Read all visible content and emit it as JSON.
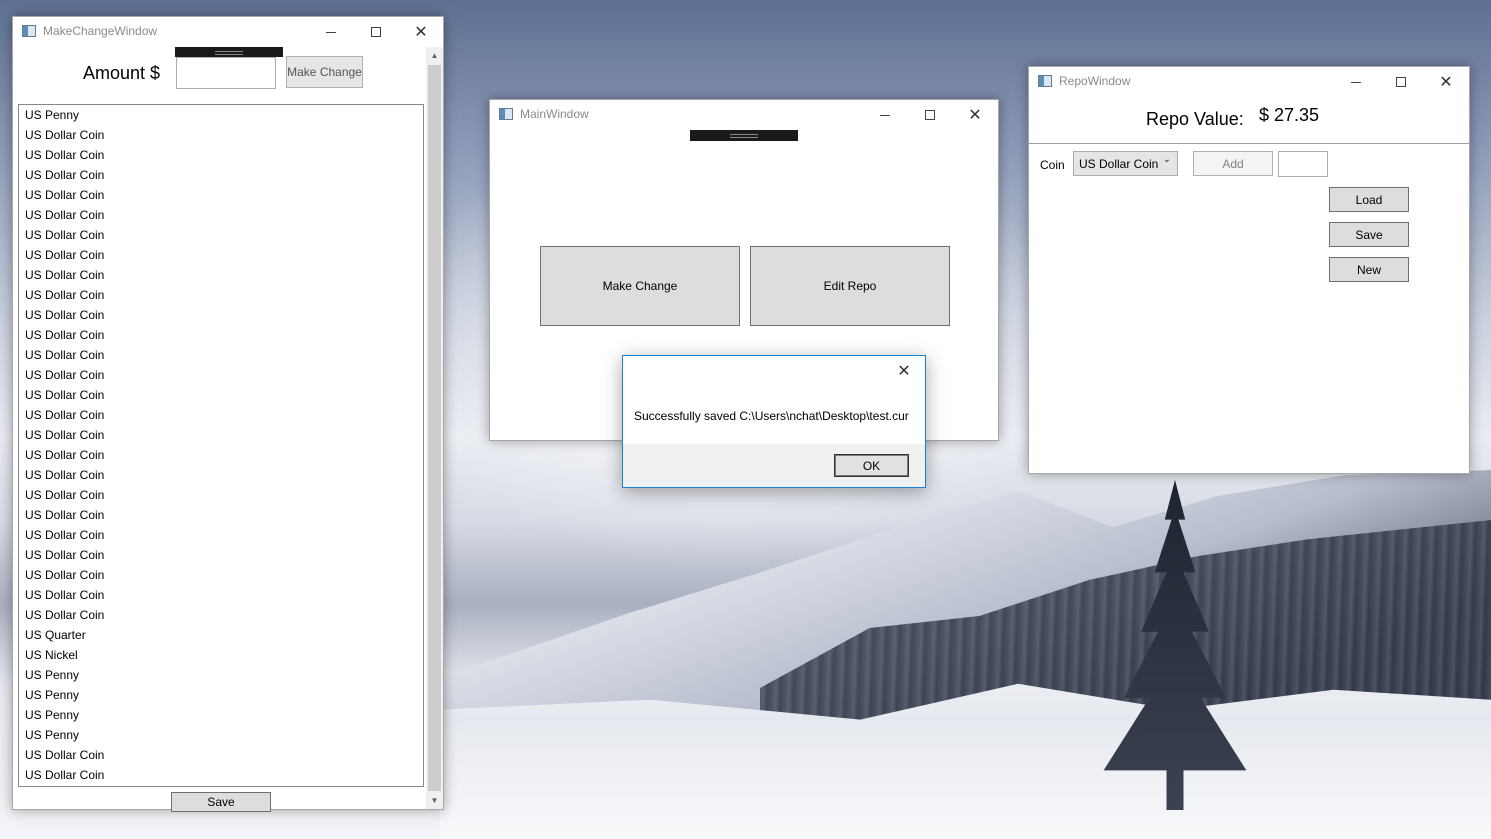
{
  "make_change_window": {
    "title": "MakeChangeWindow",
    "amount_label": "Amount $",
    "amount_value": "",
    "make_change_label": "Make Change",
    "save_label": "Save",
    "coins": [
      "US Penny",
      "US Dollar Coin",
      "US Dollar Coin",
      "US Dollar Coin",
      "US Dollar Coin",
      "US Dollar Coin",
      "US Dollar Coin",
      "US Dollar Coin",
      "US Dollar Coin",
      "US Dollar Coin",
      "US Dollar Coin",
      "US Dollar Coin",
      "US Dollar Coin",
      "US Dollar Coin",
      "US Dollar Coin",
      "US Dollar Coin",
      "US Dollar Coin",
      "US Dollar Coin",
      "US Dollar Coin",
      "US Dollar Coin",
      "US Dollar Coin",
      "US Dollar Coin",
      "US Dollar Coin",
      "US Dollar Coin",
      "US Dollar Coin",
      "US Dollar Coin",
      "US Quarter",
      "US Nickel",
      "US Penny",
      "US Penny",
      "US Penny",
      "US Penny",
      "US Dollar Coin",
      "US Dollar Coin"
    ]
  },
  "main_window": {
    "title": "MainWindow",
    "make_change_label": "Make Change",
    "edit_repo_label": "Edit Repo"
  },
  "repo_window": {
    "title": "RepoWindow",
    "repo_value_label": "Repo Value:",
    "repo_value": "$ 27.35",
    "coin_label": "Coin",
    "coin_selected": "US Dollar Coin",
    "add_label": "Add",
    "quantity_value": "",
    "load_label": "Load",
    "save_label": "Save",
    "new_label": "New"
  },
  "message_box": {
    "message": "Successfully saved C:\\Users\\nchat\\Desktop\\test.cur",
    "ok_label": "OK"
  },
  "icons": {
    "minimize": "minimize-icon",
    "maximize": "maximize-icon",
    "close": "close-icon",
    "dropdown": "chevron-down-icon"
  }
}
